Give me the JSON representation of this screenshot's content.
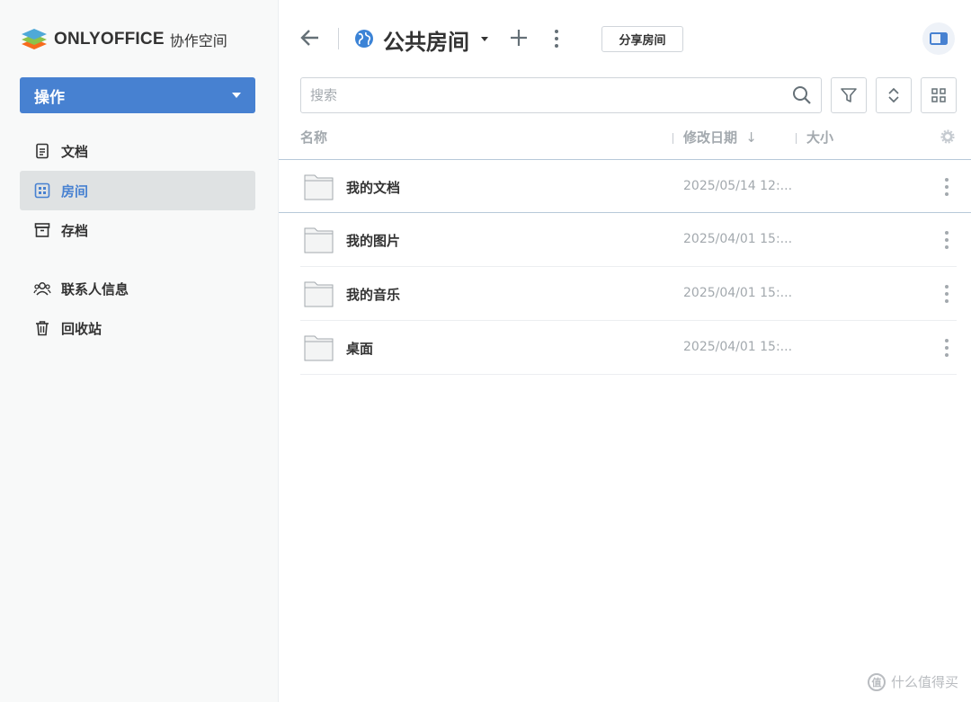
{
  "app": {
    "brand": "ONLYOFFICE",
    "brand_sub": "协作空间"
  },
  "sidebar": {
    "action_label": "操作",
    "items": [
      {
        "label": "文档",
        "icon": "document-icon"
      },
      {
        "label": "房间",
        "icon": "rooms-icon",
        "active": true
      },
      {
        "label": "存档",
        "icon": "archive-icon"
      },
      {
        "label": "联系人信息",
        "icon": "contacts-icon"
      },
      {
        "label": "回收站",
        "icon": "trash-icon"
      }
    ]
  },
  "header": {
    "room_title": "公共房间",
    "share_label": "分享房间"
  },
  "search": {
    "placeholder": "搜索"
  },
  "table": {
    "columns": {
      "name": "名称",
      "modified": "修改日期",
      "sort_indicator": "↓",
      "size": "大小"
    },
    "rows": [
      {
        "name": "我的文档",
        "date": "2025/05/14 12:..."
      },
      {
        "name": "我的图片",
        "date": "2025/04/01 15:..."
      },
      {
        "name": "我的音乐",
        "date": "2025/04/01 15:..."
      },
      {
        "name": "桌面",
        "date": "2025/04/01 15:..."
      }
    ]
  },
  "watermark": {
    "text": "什么值得买",
    "badge": "值"
  },
  "colors": {
    "accent": "#4781d1",
    "sidebar_bg": "#f8f9f9",
    "active_item_bg": "#dfe2e3",
    "muted_text": "#a3a9ae"
  }
}
